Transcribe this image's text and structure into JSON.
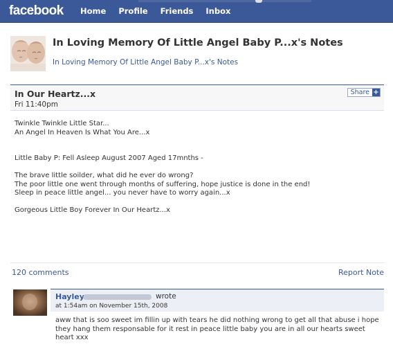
{
  "topbar": {
    "logo": "facebook",
    "nav": [
      "Home",
      "Profile",
      "Friends",
      "Inbox"
    ]
  },
  "page": {
    "title": "In Loving Memory Of Little Angel Baby P...x's Notes",
    "crumb": "In Loving Memory Of Little Angel Baby P...x's Notes"
  },
  "note": {
    "title": "In Our Heartz...x",
    "time": "Fri 11:40pm",
    "share_label": "Share",
    "share_icon": "+",
    "body": [
      "Twinkle Twinkle Little Star...",
      "An Angel In Heaven Is What You Are...x",
      "Little Baby P: Fell Asleep August 2007 Aged 17mnths -",
      "The brave little soilder, what did he ever do wrong?",
      "The poor little one went through months of suffering, hope justice is done in the end!",
      "Sleep in peace little angel... you never have to worry again...x",
      "Gorgeous Little Boy Forever In Our Heartz...x"
    ]
  },
  "footer": {
    "comments_count": "120 comments",
    "report": "Report Note"
  },
  "comment": {
    "author": "Hayley",
    "wrote": "wrote",
    "time": "at 1:54am on November 15th, 2008",
    "text": "aww that is soo sweet im fillin up with tears he did nothing wrong to get all that abuse i hope they hang them responsable for it rest in peace little baby you are in all our hearts sweet heart xxx"
  },
  "colors": {
    "brand": "#3b5998",
    "header_bg": "#f7f7f7",
    "comment_head_bg": "#eceff5"
  }
}
